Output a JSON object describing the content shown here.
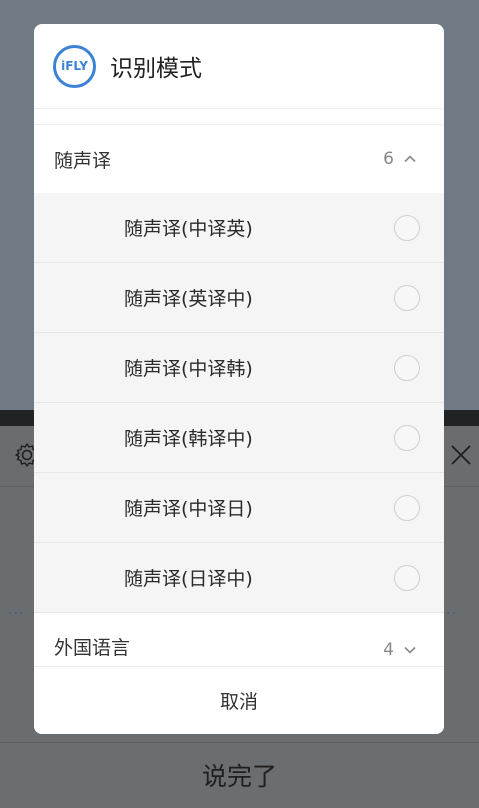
{
  "background": {
    "done_label": "说完了",
    "dots_left": "···",
    "dots_right": "··",
    "icons": {
      "settings": "gear-icon",
      "close": "close-icon"
    }
  },
  "dialog": {
    "logo_text": "iFLY",
    "title": "识别模式",
    "groups": [
      {
        "label": "随声译",
        "count": "6",
        "expanded": true,
        "options": [
          {
            "label": "随声译(中译英)",
            "selected": false
          },
          {
            "label": "随声译(英译中)",
            "selected": false
          },
          {
            "label": "随声译(中译韩)",
            "selected": false
          },
          {
            "label": "随声译(韩译中)",
            "selected": false
          },
          {
            "label": "随声译(中译日)",
            "selected": false
          },
          {
            "label": "随声译(日译中)",
            "selected": false
          }
        ]
      },
      {
        "label": "外国语言",
        "count": "4",
        "expanded": false
      }
    ],
    "cancel_label": "取消"
  },
  "colors": {
    "accent": "#3b82d6",
    "overlay": "#6d7881"
  }
}
